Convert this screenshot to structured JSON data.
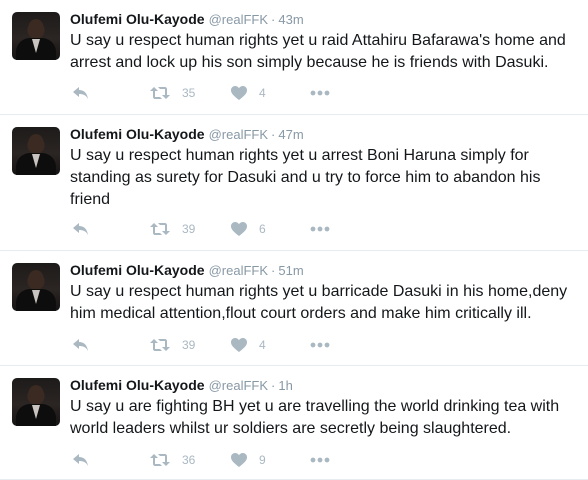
{
  "tweets": [
    {
      "name": "Olufemi Olu-Kayode",
      "handle": "@realFFK",
      "separator": "·",
      "time": "43m",
      "text": "U say u respect human rights yet u raid Attahiru Bafarawa's home and arrest and lock up his son simply because he is friends with Dasuki.",
      "retweets": "35",
      "likes": "4"
    },
    {
      "name": "Olufemi Olu-Kayode",
      "handle": "@realFFK",
      "separator": "·",
      "time": "47m",
      "text": "U say u respect human rights yet u arrest Boni Haruna simply for standing as surety for Dasuki and u try to force him to abandon his friend",
      "retweets": "39",
      "likes": "6"
    },
    {
      "name": "Olufemi Olu-Kayode",
      "handle": "@realFFK",
      "separator": "·",
      "time": "51m",
      "text": "U say u respect human rights yet u barricade Dasuki in his home,deny him medical attention,flout court orders and make him critically ill.",
      "retweets": "39",
      "likes": "4"
    },
    {
      "name": "Olufemi Olu-Kayode",
      "handle": "@realFFK",
      "separator": "·",
      "time": "1h",
      "text": "U say u are fighting BH yet u are travelling the world drinking tea with world leaders whilst ur soldiers are secretly being slaughtered.",
      "retweets": "36",
      "likes": "9"
    }
  ],
  "icons": {
    "reply": "reply-icon",
    "retweet": "retweet-icon",
    "like": "heart-icon",
    "more": "more-dots-icon"
  },
  "colors": {
    "text": "#14171a",
    "muted": "#8899a6",
    "action": "#aab8c2",
    "divider": "#e6ecf0"
  }
}
